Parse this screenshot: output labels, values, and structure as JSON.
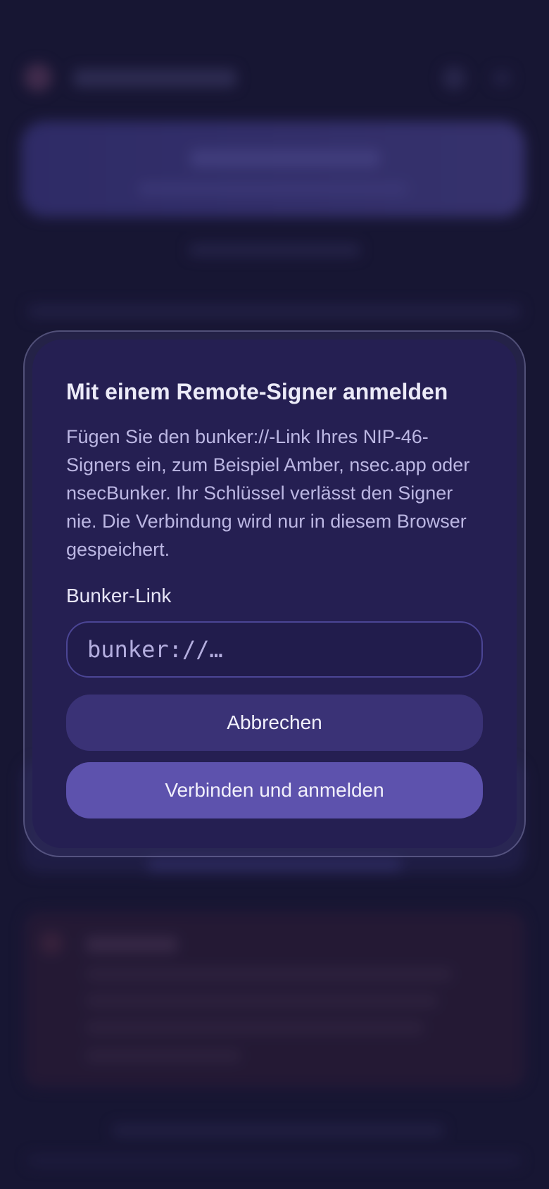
{
  "modal": {
    "title": "Mit einem Remote-Signer anmelden",
    "description": "Fügen Sie den bunker://-Link Ihres NIP-46-Signers ein, zum Beispiel Amber, nsec.app oder nsecBunker. Ihr Schlüssel verlässt den Signer nie. Die Verbindung wird nur in diesem Browser gespeichert.",
    "field_label": "Bunker-Link",
    "input_placeholder": "bunker://…",
    "input_value": "",
    "cancel_label": "Abbrechen",
    "connect_label": "Verbinden und anmelden"
  },
  "colors": {
    "background": "#1b1938",
    "modal_background": "#251f52",
    "cancel_button": "#3a3276",
    "primary_button": "#5d52ad"
  }
}
